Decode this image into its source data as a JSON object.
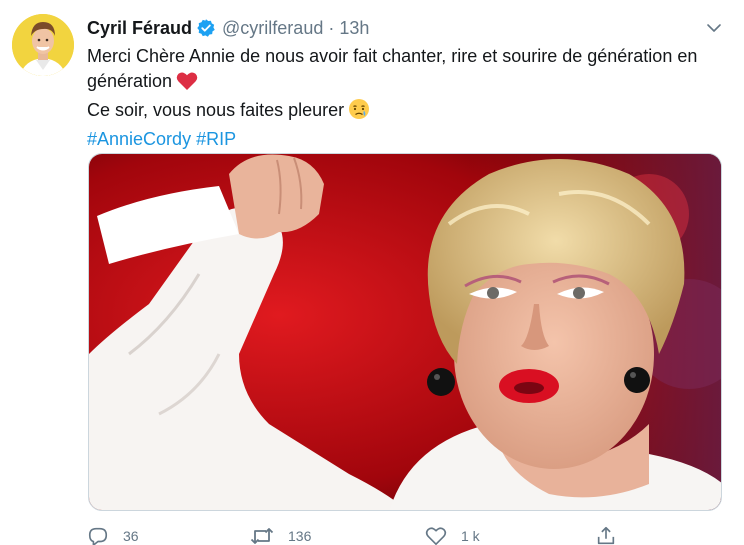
{
  "tweet": {
    "author": {
      "name": "Cyril Féraud",
      "handle": "@cyrilferaud",
      "avatar_icon": "profile-avatar"
    },
    "separator": "·",
    "time": "13h",
    "text": {
      "line1": "Merci Chère Annie de nous avoir fait chanter, rire et sourire de génération en génération",
      "line1_emoji": "red-heart-emoji",
      "line2": "Ce soir, vous nous faites pleurer",
      "line2_emoji": "crying-face-emoji",
      "hashtags": [
        "#AnnieCordy",
        "#RIP"
      ]
    },
    "media": {
      "description": ""
    },
    "actions": {
      "reply_count": "36",
      "retweet_count": "136",
      "like_count": "1 k"
    },
    "colors": {
      "link": "#1b95e0",
      "verified": "#1da1f2",
      "muted": "#657786",
      "heart": "#dd2e44"
    }
  }
}
